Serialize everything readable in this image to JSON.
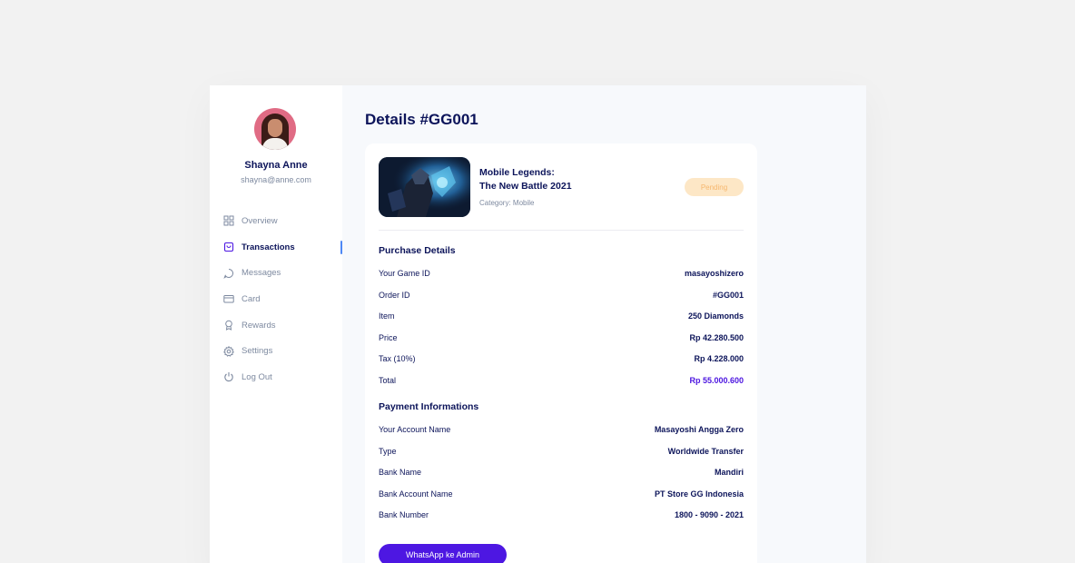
{
  "user": {
    "name": "Shayna Anne",
    "email": "shayna@anne.com"
  },
  "nav": [
    {
      "label": "Overview",
      "icon": "grid-icon"
    },
    {
      "label": "Transactions",
      "icon": "bag-icon",
      "active": true
    },
    {
      "label": "Messages",
      "icon": "chat-icon"
    },
    {
      "label": "Card",
      "icon": "card-icon"
    },
    {
      "label": "Rewards",
      "icon": "award-icon"
    },
    {
      "label": "Settings",
      "icon": "gear-icon"
    },
    {
      "label": "Log Out",
      "icon": "power-icon"
    }
  ],
  "page": {
    "title": "Details #GG001"
  },
  "game": {
    "title_line1": "Mobile Legends:",
    "title_line2": "The New Battle 2021",
    "category": "Category: Mobile",
    "status": "Pending"
  },
  "purchase": {
    "title": "Purchase Details",
    "rows": [
      {
        "label": "Your Game ID",
        "value": "masayoshizero"
      },
      {
        "label": "Order ID",
        "value": "#GG001"
      },
      {
        "label": "Item",
        "value": "250 Diamonds"
      },
      {
        "label": "Price",
        "value": "Rp 42.280.500"
      },
      {
        "label": "Tax (10%)",
        "value": "Rp 4.228.000"
      },
      {
        "label": "Total",
        "value": "Rp 55.000.600"
      }
    ]
  },
  "payment": {
    "title": "Payment Informations",
    "rows": [
      {
        "label": "Your Account Name",
        "value": "Masayoshi Angga Zero"
      },
      {
        "label": "Type",
        "value": "Worldwide Transfer"
      },
      {
        "label": "Bank Name",
        "value": "Mandiri"
      },
      {
        "label": "Bank Account Name",
        "value": "PT Store GG Indonesia"
      },
      {
        "label": "Bank Number",
        "value": "1800 - 9090 - 2021"
      }
    ]
  },
  "actions": {
    "whatsapp_label": "WhatsApp ke Admin"
  },
  "colors": {
    "primary": "#4d17e2",
    "navy": "#0c145a",
    "muted": "#7e8aa0",
    "pending_bg": "#fde7c6",
    "pending_text": "#f6b76e",
    "active_indicator": "#4e88f5"
  }
}
